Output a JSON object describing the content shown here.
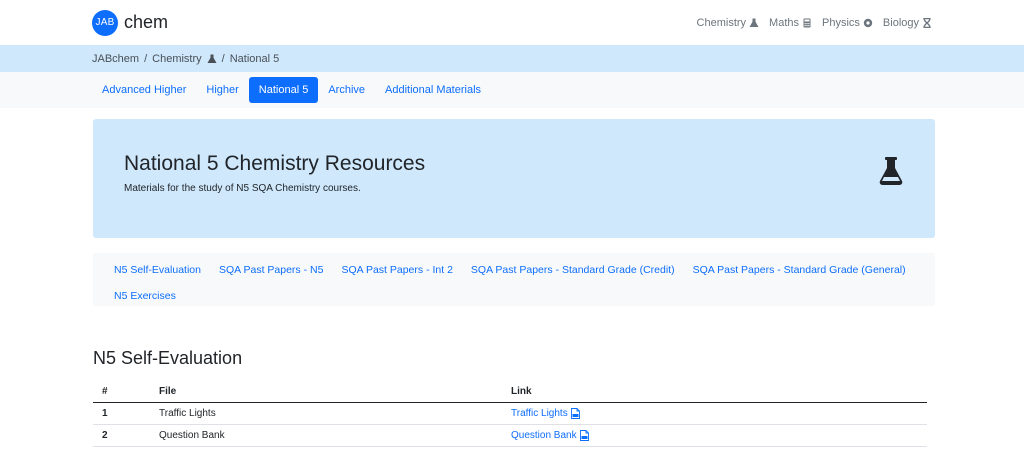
{
  "brand": {
    "logo_text": "JAB",
    "name": "chem"
  },
  "nav": [
    {
      "label": "Chemistry",
      "icon": "flask-icon"
    },
    {
      "label": "Maths",
      "icon": "calculator-icon"
    },
    {
      "label": "Physics",
      "icon": "atom-icon"
    },
    {
      "label": "Biology",
      "icon": "dna-icon"
    }
  ],
  "breadcrumb": {
    "home": "JABchem",
    "sep1": "/",
    "section": "Chemistry",
    "sep2": "/",
    "current": "National 5"
  },
  "tabs": [
    {
      "label": "Advanced Higher",
      "active": false
    },
    {
      "label": "Higher",
      "active": false
    },
    {
      "label": "National 5",
      "active": true
    },
    {
      "label": "Archive",
      "active": false
    },
    {
      "label": "Additional Materials",
      "active": false
    }
  ],
  "hero": {
    "title": "National 5 Chemistry Resources",
    "subtitle": "Materials for the study of N5 SQA Chemistry courses.",
    "icon": "flask-icon"
  },
  "subnav": [
    "N5 Self-Evaluation",
    "SQA Past Papers - N5",
    "SQA Past Papers - Int 2",
    "SQA Past Papers - Standard Grade (Credit)",
    "SQA Past Papers - Standard Grade (General)",
    "N5 Exercises"
  ],
  "section": {
    "title": "N5 Self-Evaluation",
    "headers": {
      "num": "#",
      "file": "File",
      "link": "Link"
    },
    "rows": [
      {
        "num": "1",
        "file": "Traffic Lights",
        "link": "Traffic Lights"
      },
      {
        "num": "2",
        "file": "Question Bank",
        "link": "Question Bank"
      }
    ]
  },
  "colors": {
    "accent": "#0d6efd",
    "hero_bg": "#cfe8fc",
    "tabs_bg": "#f8f9fa"
  }
}
